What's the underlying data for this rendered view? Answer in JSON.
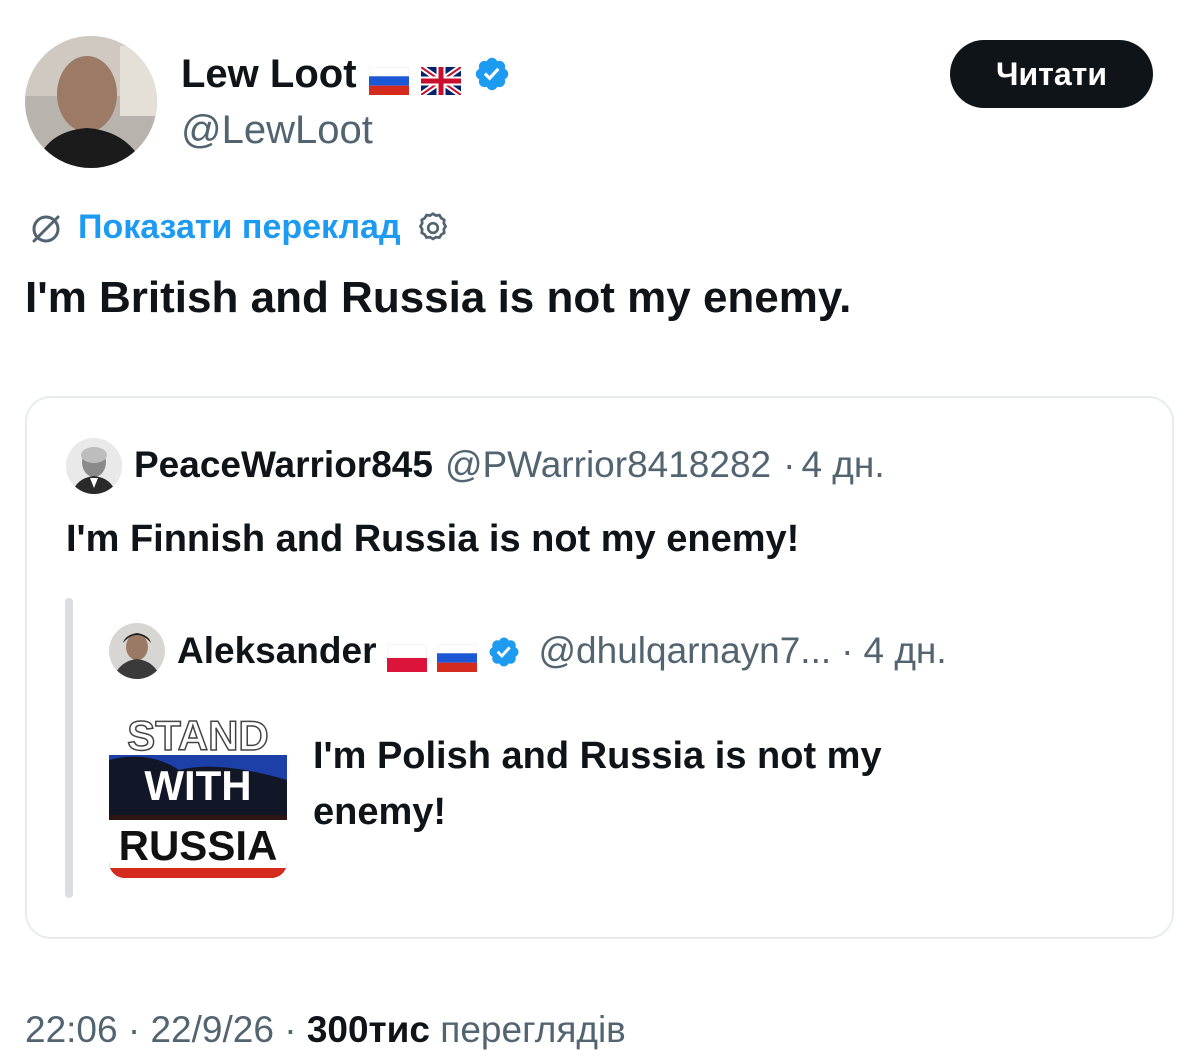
{
  "author": {
    "name": "Lew Loot",
    "handle": "@LewLoot",
    "flags": [
      "russia-flag-icon",
      "uk-flag-icon"
    ],
    "verified": true
  },
  "follow_button_label": "Читати",
  "translate": {
    "label": "Показати переклад"
  },
  "tweet_text": "I'm British and Russia is not my enemy.",
  "quote": {
    "name": "PeaceWarrior845",
    "handle": "@PWarrior8418282",
    "separator": "·",
    "time": "4 дн.",
    "text": "I'm Finnish and Russia is not my enemy!",
    "nested": {
      "name": "Aleksander",
      "flags": [
        "poland-flag-icon",
        "russia-flag-icon"
      ],
      "verified": true,
      "handle": "@dhulqarnayn7...",
      "separator": "·",
      "time": "4 дн.",
      "text": "I'm Polish and Russia is not my enemy!",
      "image_text": {
        "line1": "STAND",
        "line2": "WITH",
        "line3": "RUSSIA"
      }
    }
  },
  "footer": {
    "time": "22:06",
    "date": "22/9/26",
    "views_count": "300тис",
    "views_label": "переглядів",
    "separator": "·"
  },
  "colors": {
    "accent": "#1d9bf0",
    "text": "#0f1419",
    "muted": "#536471",
    "border": "#e8ecef"
  }
}
